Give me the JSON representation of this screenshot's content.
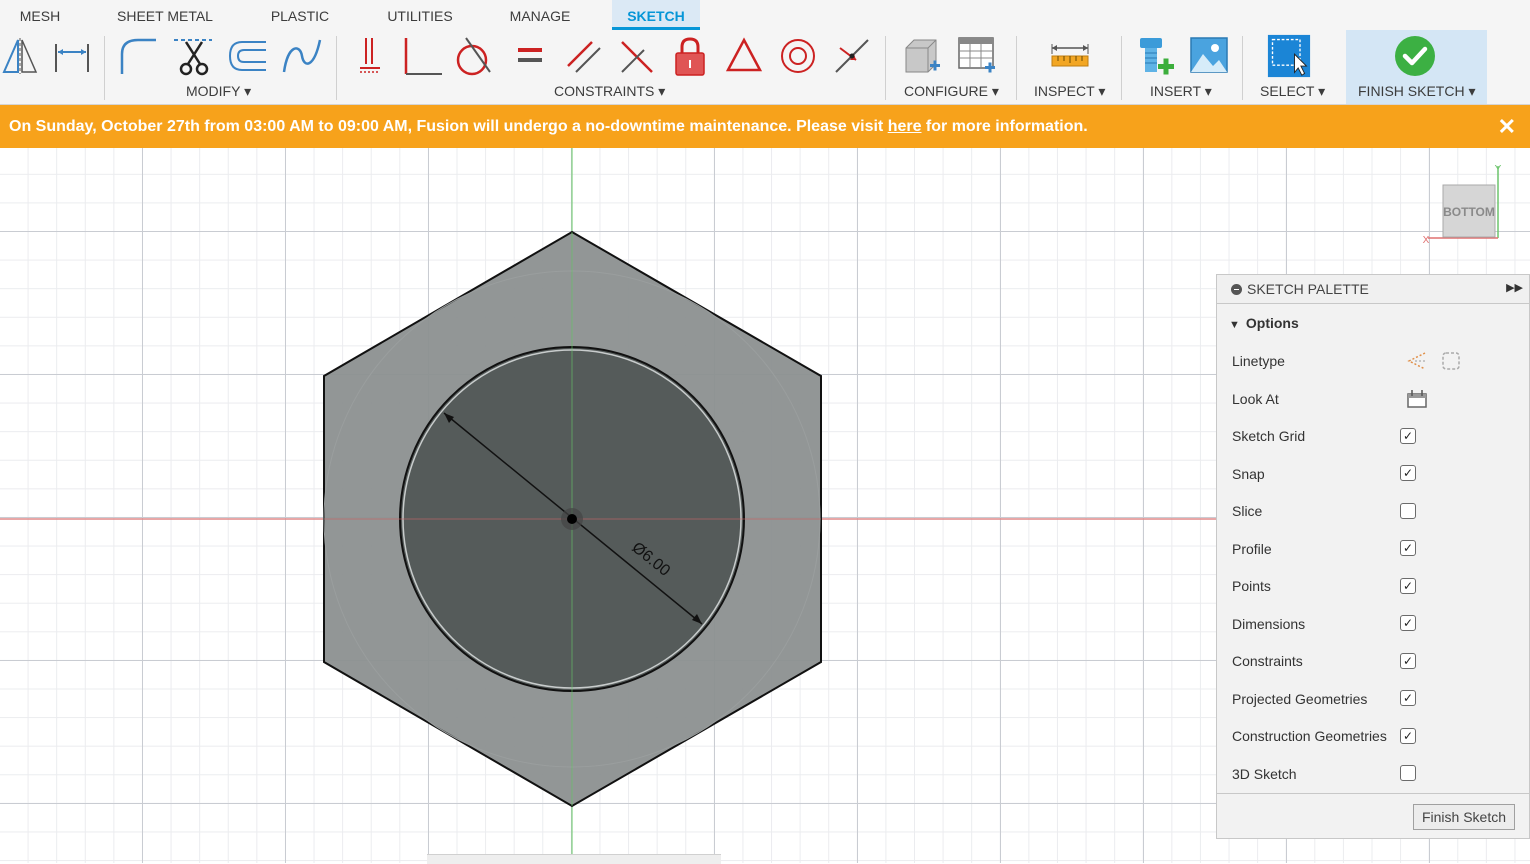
{
  "tabs": [
    {
      "label": "MESH",
      "active": false
    },
    {
      "label": "SHEET METAL",
      "active": false
    },
    {
      "label": "PLASTIC",
      "active": false
    },
    {
      "label": "UTILITIES",
      "active": false
    },
    {
      "label": "MANAGE",
      "active": false
    },
    {
      "label": "SKETCH",
      "active": true
    }
  ],
  "toolbar": {
    "modify_label": "MODIFY ▾",
    "constraints_label": "CONSTRAINTS ▾",
    "configure_label": "CONFIGURE ▾",
    "inspect_label": "INSPECT ▾",
    "insert_label": "INSERT ▾",
    "select_label": "SELECT ▾",
    "finish_sketch_label": "FINISH SKETCH ▾"
  },
  "banner": {
    "text_before": "On Sunday, October 27th from 03:00 AM to 09:00 AM, Fusion will undergo a no-downtime maintenance. Please visit ",
    "link_text": "here",
    "text_after": " for more information.",
    "close": "✕"
  },
  "sketch": {
    "dimension_text": "Ø6.00"
  },
  "viewcube": {
    "face_label": "BOTTOM",
    "y_axis": "Y",
    "x_axis": "X"
  },
  "palette": {
    "title": "SKETCH PALETTE",
    "section": "Options",
    "linetype_label": "Linetype",
    "lookat_label": "Look At",
    "options": [
      {
        "label": "Sketch Grid",
        "checked": true
      },
      {
        "label": "Snap",
        "checked": true
      },
      {
        "label": "Slice",
        "checked": false
      },
      {
        "label": "Profile",
        "checked": true
      },
      {
        "label": "Points",
        "checked": true
      },
      {
        "label": "Dimensions",
        "checked": true
      },
      {
        "label": "Constraints",
        "checked": true
      },
      {
        "label": "Projected Geometries",
        "checked": true
      },
      {
        "label": "Construction Geometries",
        "checked": true
      },
      {
        "label": "3D Sketch",
        "checked": false
      }
    ],
    "finish_button": "Finish Sketch"
  },
  "colors": {
    "accent": "#0696d7",
    "banner": "#f7a21b",
    "x_axis": "#d9534f",
    "y_axis": "#4caf50",
    "constraint_red": "#cc2222"
  }
}
